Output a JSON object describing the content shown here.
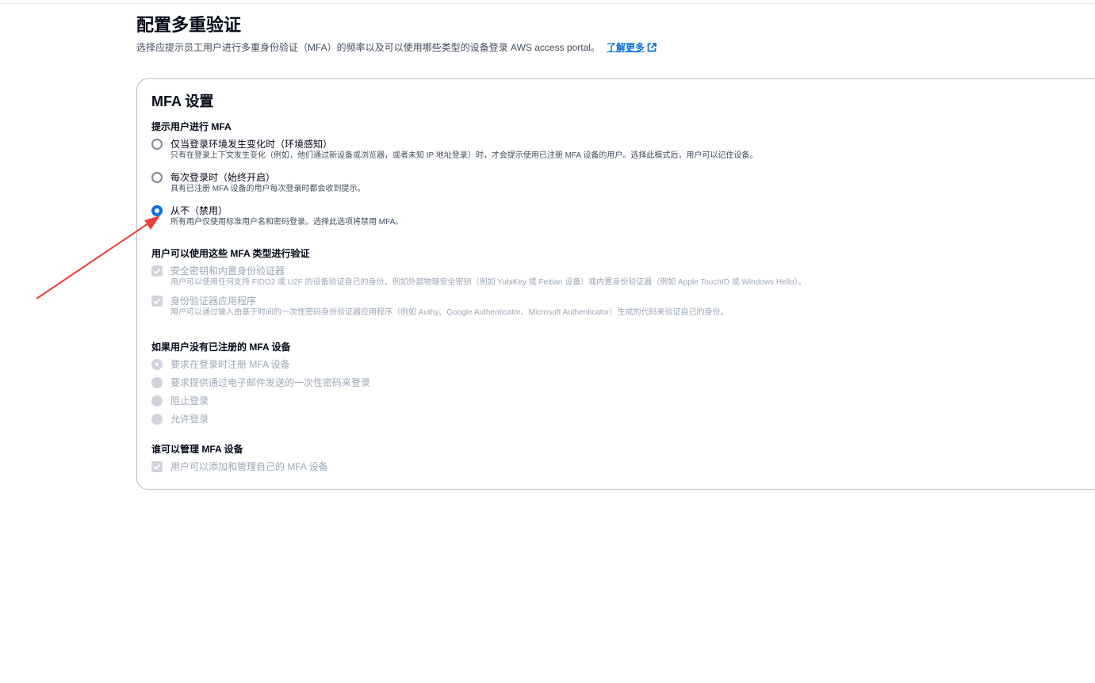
{
  "header": {
    "title": "配置多重验证",
    "description": "选择应提示员工用户进行多重身份验证（MFA）的频率以及可以使用哪些类型的设备登录 AWS access portal。",
    "learn_more": "了解更多"
  },
  "card": {
    "title": "MFA 设置",
    "prompt_section": {
      "label": "提示用户进行 MFA",
      "options": [
        {
          "label": "仅当登录环境发生变化时（环境感知）",
          "description": "只有在登录上下文发生变化（例如，他们通过新设备或浏览器，或者未知 IP 地址登录）时，才会提示使用已注册 MFA 设备的用户。选择此模式后，用户可以记住设备。",
          "selected": false
        },
        {
          "label": "每次登录时（始终开启）",
          "description": "具有已注册 MFA 设备的用户每次登录时都会收到提示。",
          "selected": false
        },
        {
          "label": "从不（禁用）",
          "description": "所有用户仅使用标准用户名和密码登录。选择此选项将禁用 MFA。",
          "selected": true
        }
      ]
    },
    "types_section": {
      "label": "用户可以使用这些 MFA 类型进行验证",
      "options": [
        {
          "label": "安全密钥和内置身份验证器",
          "description": "用户可以使用任何支持 FIDO2 或 U2F 的设备验证自己的身份，例如外部物理安全密钥（例如 YubiKey 或 Feitian 设备）或内置身份验证器（例如 Apple TouchID 或 Windows Hello）。",
          "checked": true,
          "disabled": true
        },
        {
          "label": "身份验证器应用程序",
          "description": "用户可以通过输入由基于时间的一次性密码身份验证器应用程序（例如 Authy、Google Authenticator、Microsoft Authenticator）生成的代码来验证自己的身份。",
          "checked": true,
          "disabled": true
        }
      ]
    },
    "no_device_section": {
      "label": "如果用户没有已注册的 MFA 设备",
      "options": [
        {
          "label": "要求在登录时注册 MFA 设备",
          "selected": true,
          "disabled": true
        },
        {
          "label": "要求提供通过电子邮件发送的一次性密码来登录",
          "selected": false,
          "disabled": true
        },
        {
          "label": "阻止登录",
          "selected": false,
          "disabled": true
        },
        {
          "label": "允许登录",
          "selected": false,
          "disabled": true
        }
      ]
    },
    "manage_section": {
      "label": "谁可以管理 MFA 设备",
      "options": [
        {
          "label": "用户可以添加和管理自己的 MFA 设备",
          "checked": true,
          "disabled": true
        }
      ]
    }
  },
  "colors": {
    "accent": "#0972d3",
    "annotation_arrow": "#e8403a",
    "disabled": "#9ba7b6"
  }
}
